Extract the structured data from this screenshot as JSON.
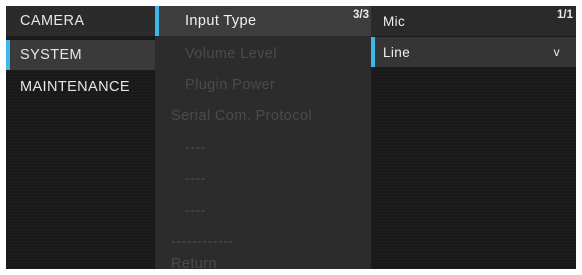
{
  "left_menu": {
    "items": [
      {
        "label": "CAMERA"
      },
      {
        "label": "SYSTEM"
      },
      {
        "label": "MAINTENANCE"
      }
    ]
  },
  "mid_menu": {
    "page": "3/3",
    "items": [
      {
        "label": "Input Type"
      },
      {
        "label": "Volume Level"
      },
      {
        "label": "Plugin Power"
      },
      {
        "label": "Serial Com. Protocol"
      },
      {
        "label": "----"
      },
      {
        "label": "----"
      },
      {
        "label": "----"
      },
      {
        "label": "------------"
      },
      {
        "label": "Return"
      }
    ]
  },
  "right_menu": {
    "page": "1/1",
    "items": [
      {
        "label": "Mic"
      },
      {
        "label": "Line",
        "marker": "v"
      }
    ]
  },
  "colors": {
    "accent": "#3fb7e8",
    "panel": "#2c2c2c",
    "background": "#1a1a1a",
    "disabled_text": "#4b4b4b"
  }
}
